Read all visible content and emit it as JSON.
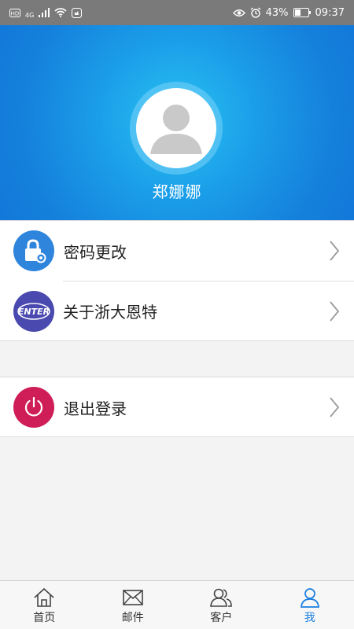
{
  "status_bar": {
    "network": "4G",
    "battery": "43%",
    "time": "09:37"
  },
  "profile": {
    "name": "郑娜娜"
  },
  "menu": {
    "items": [
      {
        "label": "密码更改",
        "icon": "lock-gear-icon",
        "color": "#2f84dc"
      },
      {
        "label": "关于浙大恩特",
        "icon": "enter-logo-icon",
        "icon_text": "ENTER",
        "color": "#4a49b0"
      }
    ],
    "logout": {
      "label": "退出登录",
      "icon": "power-icon",
      "color": "#cf1d57"
    }
  },
  "tabs": [
    {
      "label": "首页",
      "icon": "home-icon",
      "active": false
    },
    {
      "label": "邮件",
      "icon": "mail-icon",
      "active": false
    },
    {
      "label": "客户",
      "icon": "customers-icon",
      "active": false
    },
    {
      "label": "我",
      "icon": "person-icon",
      "active": true
    }
  ],
  "colors": {
    "accent": "#1b7fe0",
    "header_blue": "#1581dc"
  }
}
